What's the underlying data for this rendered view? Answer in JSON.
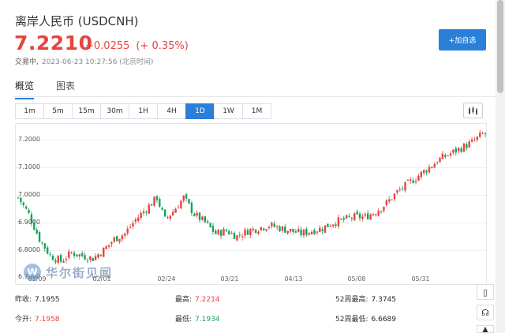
{
  "header": {
    "title": "离岸人民币 (USDCNH)",
    "price": "7.2210",
    "change": "+0.0255",
    "change_pct": "(+ 0.35%)",
    "status": "交易中,",
    "datetime": "2023-06-23 10:27:56 (北京时间)",
    "add_watchlist": "+加自选"
  },
  "tabs": [
    "概览",
    "图表"
  ],
  "periods": [
    "1m",
    "5m",
    "15m",
    "30m",
    "1H",
    "4H",
    "1D",
    "1W",
    "1M"
  ],
  "active_period": "1D",
  "chart_data": {
    "type": "candlestick",
    "y_ticks": [
      "7.2000",
      "7.1000",
      "7.0000",
      "6.9000",
      "6.8000",
      "6.7000"
    ],
    "x_ticks": [
      "01/09",
      "02/01",
      "02/24",
      "03/21",
      "04/13",
      "05/08",
      "05/31"
    ],
    "up_color": "#e8433f",
    "down_color": "#18a35a",
    "close_path": [
      [
        0,
        6.99
      ],
      [
        4,
        6.93
      ],
      [
        8,
        6.84
      ],
      [
        12,
        6.78
      ],
      [
        16,
        6.76
      ],
      [
        20,
        6.79
      ],
      [
        24,
        6.78
      ],
      [
        28,
        6.77
      ],
      [
        32,
        6.8
      ],
      [
        36,
        6.84
      ],
      [
        40,
        6.86
      ],
      [
        44,
        6.91
      ],
      [
        48,
        6.95
      ],
      [
        52,
        6.99
      ],
      [
        55,
        6.91
      ],
      [
        58,
        6.94
      ],
      [
        62,
        6.99
      ],
      [
        66,
        6.93
      ],
      [
        70,
        6.9
      ],
      [
        74,
        6.86
      ],
      [
        78,
        6.87
      ],
      [
        82,
        6.85
      ],
      [
        86,
        6.87
      ],
      [
        90,
        6.88
      ],
      [
        94,
        6.89
      ],
      [
        98,
        6.88
      ],
      [
        102,
        6.87
      ],
      [
        106,
        6.86
      ],
      [
        110,
        6.87
      ],
      [
        114,
        6.88
      ],
      [
        118,
        6.9
      ],
      [
        122,
        6.91
      ],
      [
        126,
        6.92
      ],
      [
        130,
        6.92
      ],
      [
        134,
        6.94
      ],
      [
        138,
        6.97
      ],
      [
        142,
        7.01
      ],
      [
        146,
        7.04
      ],
      [
        150,
        7.07
      ],
      [
        154,
        7.1
      ],
      [
        158,
        7.13
      ],
      [
        162,
        7.15
      ],
      [
        166,
        7.17
      ],
      [
        170,
        7.19
      ],
      [
        174,
        7.22
      ]
    ]
  },
  "watermark": "华尔街见闻",
  "stats": {
    "prev_close_label": "昨收:",
    "prev_close": "7.1955",
    "open_label": "今开:",
    "open": "7.1958",
    "high_label": "最高:",
    "high": "7.2214",
    "low_label": "最低:",
    "low": "7.1934",
    "w52_high_label": "52周最高:",
    "w52_high": "7.3745",
    "w52_low_label": "52周最低:",
    "w52_low": "6.6689"
  },
  "side_icons": [
    "mobile-icon",
    "headset-icon",
    "up-arrow-icon"
  ]
}
